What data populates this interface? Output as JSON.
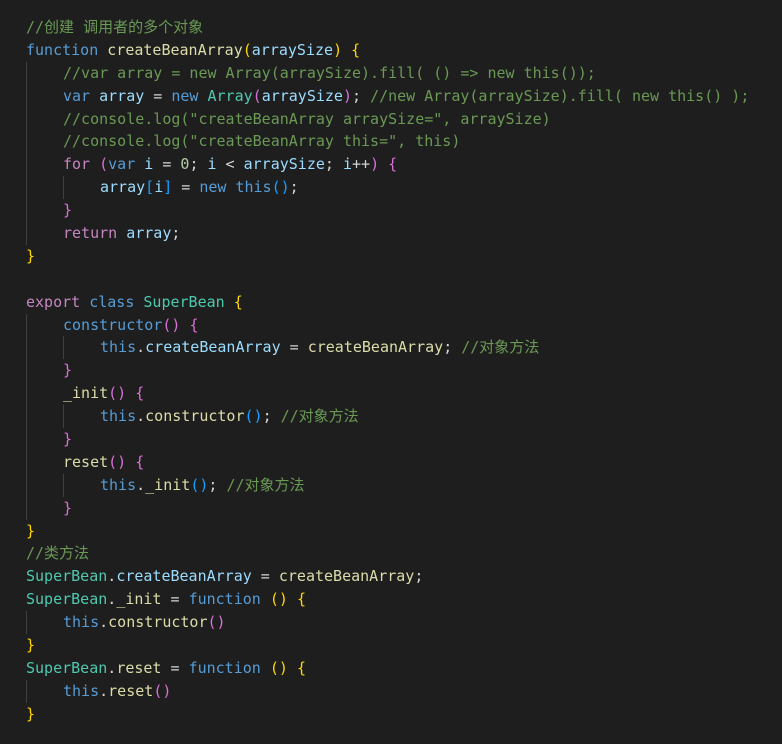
{
  "editor": {
    "language": "javascript",
    "theme_background": "#1e1e1e",
    "lines": [
      {
        "indent": 0,
        "tokens": [
          {
            "t": "//创建 调用者的多个对象",
            "c": "comment"
          }
        ]
      },
      {
        "indent": 0,
        "tokens": [
          {
            "t": "function",
            "c": "kw"
          },
          {
            "t": " ",
            "c": "op"
          },
          {
            "t": "createBeanArray",
            "c": "fn"
          },
          {
            "t": "(",
            "c": "b1"
          },
          {
            "t": "arraySize",
            "c": "var"
          },
          {
            "t": ")",
            "c": "b1"
          },
          {
            "t": " ",
            "c": "op"
          },
          {
            "t": "{",
            "c": "b1"
          }
        ]
      },
      {
        "indent": 1,
        "tokens": [
          {
            "t": "//var array = new Array(arraySize).fill( () => new this());",
            "c": "comment"
          }
        ]
      },
      {
        "indent": 1,
        "tokens": [
          {
            "t": "var",
            "c": "kw"
          },
          {
            "t": " ",
            "c": "op"
          },
          {
            "t": "array",
            "c": "var"
          },
          {
            "t": " = ",
            "c": "op"
          },
          {
            "t": "new",
            "c": "kw"
          },
          {
            "t": " ",
            "c": "op"
          },
          {
            "t": "Array",
            "c": "cls"
          },
          {
            "t": "(",
            "c": "b2"
          },
          {
            "t": "arraySize",
            "c": "var"
          },
          {
            "t": ")",
            "c": "b2"
          },
          {
            "t": "; ",
            "c": "op"
          },
          {
            "t": "//new Array(arraySize).fill( new this() );",
            "c": "comment"
          }
        ]
      },
      {
        "indent": 1,
        "tokens": [
          {
            "t": "//console.log(\"createBeanArray arraySize=\", arraySize)",
            "c": "comment"
          }
        ]
      },
      {
        "indent": 1,
        "tokens": [
          {
            "t": "//console.log(\"createBeanArray this=\", this)",
            "c": "comment"
          }
        ]
      },
      {
        "indent": 1,
        "tokens": [
          {
            "t": "for",
            "c": "ctrl"
          },
          {
            "t": " ",
            "c": "op"
          },
          {
            "t": "(",
            "c": "b2"
          },
          {
            "t": "var",
            "c": "kw"
          },
          {
            "t": " ",
            "c": "op"
          },
          {
            "t": "i",
            "c": "var"
          },
          {
            "t": " = ",
            "c": "op"
          },
          {
            "t": "0",
            "c": "num"
          },
          {
            "t": "; ",
            "c": "op"
          },
          {
            "t": "i",
            "c": "var"
          },
          {
            "t": " < ",
            "c": "op"
          },
          {
            "t": "arraySize",
            "c": "var"
          },
          {
            "t": "; ",
            "c": "op"
          },
          {
            "t": "i",
            "c": "var"
          },
          {
            "t": "++",
            "c": "op"
          },
          {
            "t": ")",
            "c": "b2"
          },
          {
            "t": " ",
            "c": "op"
          },
          {
            "t": "{",
            "c": "b2"
          }
        ]
      },
      {
        "indent": 2,
        "tokens": [
          {
            "t": "array",
            "c": "var"
          },
          {
            "t": "[",
            "c": "b3"
          },
          {
            "t": "i",
            "c": "var"
          },
          {
            "t": "]",
            "c": "b3"
          },
          {
            "t": " = ",
            "c": "op"
          },
          {
            "t": "new",
            "c": "kw"
          },
          {
            "t": " ",
            "c": "op"
          },
          {
            "t": "this",
            "c": "kw"
          },
          {
            "t": "()",
            "c": "b3"
          },
          {
            "t": ";",
            "c": "op"
          }
        ]
      },
      {
        "indent": 1,
        "tokens": [
          {
            "t": "}",
            "c": "b2"
          }
        ]
      },
      {
        "indent": 1,
        "tokens": [
          {
            "t": "return",
            "c": "ctrl"
          },
          {
            "t": " ",
            "c": "op"
          },
          {
            "t": "array",
            "c": "var"
          },
          {
            "t": ";",
            "c": "op"
          }
        ]
      },
      {
        "indent": 0,
        "tokens": [
          {
            "t": "}",
            "c": "b1"
          }
        ]
      },
      {
        "indent": 0,
        "tokens": []
      },
      {
        "indent": 0,
        "tokens": [
          {
            "t": "export",
            "c": "ctrl"
          },
          {
            "t": " ",
            "c": "op"
          },
          {
            "t": "class",
            "c": "kw"
          },
          {
            "t": " ",
            "c": "op"
          },
          {
            "t": "SuperBean",
            "c": "cls"
          },
          {
            "t": " ",
            "c": "op"
          },
          {
            "t": "{",
            "c": "b1"
          }
        ]
      },
      {
        "indent": 1,
        "tokens": [
          {
            "t": "constructor",
            "c": "kw"
          },
          {
            "t": "()",
            "c": "b2"
          },
          {
            "t": " ",
            "c": "op"
          },
          {
            "t": "{",
            "c": "b2"
          }
        ]
      },
      {
        "indent": 2,
        "tokens": [
          {
            "t": "this",
            "c": "kw"
          },
          {
            "t": ".",
            "c": "op"
          },
          {
            "t": "createBeanArray",
            "c": "var"
          },
          {
            "t": " = ",
            "c": "op"
          },
          {
            "t": "createBeanArray",
            "c": "fn"
          },
          {
            "t": "; ",
            "c": "op"
          },
          {
            "t": "//对象方法",
            "c": "comment"
          }
        ]
      },
      {
        "indent": 1,
        "tokens": [
          {
            "t": "}",
            "c": "b2"
          }
        ]
      },
      {
        "indent": 1,
        "tokens": [
          {
            "t": "_init",
            "c": "fn"
          },
          {
            "t": "()",
            "c": "b2"
          },
          {
            "t": " ",
            "c": "op"
          },
          {
            "t": "{",
            "c": "b2"
          }
        ]
      },
      {
        "indent": 2,
        "tokens": [
          {
            "t": "this",
            "c": "kw"
          },
          {
            "t": ".",
            "c": "op"
          },
          {
            "t": "constructor",
            "c": "fn"
          },
          {
            "t": "()",
            "c": "b3"
          },
          {
            "t": "; ",
            "c": "op"
          },
          {
            "t": "//对象方法",
            "c": "comment"
          }
        ]
      },
      {
        "indent": 1,
        "tokens": [
          {
            "t": "}",
            "c": "b2"
          }
        ]
      },
      {
        "indent": 1,
        "tokens": [
          {
            "t": "reset",
            "c": "fn"
          },
          {
            "t": "()",
            "c": "b2"
          },
          {
            "t": " ",
            "c": "op"
          },
          {
            "t": "{",
            "c": "b2"
          }
        ]
      },
      {
        "indent": 2,
        "tokens": [
          {
            "t": "this",
            "c": "kw"
          },
          {
            "t": ".",
            "c": "op"
          },
          {
            "t": "_init",
            "c": "fn"
          },
          {
            "t": "()",
            "c": "b3"
          },
          {
            "t": "; ",
            "c": "op"
          },
          {
            "t": "//对象方法",
            "c": "comment"
          }
        ]
      },
      {
        "indent": 1,
        "tokens": [
          {
            "t": "}",
            "c": "b2"
          }
        ]
      },
      {
        "indent": 0,
        "tokens": [
          {
            "t": "}",
            "c": "b1"
          }
        ]
      },
      {
        "indent": 0,
        "tokens": [
          {
            "t": "//类方法",
            "c": "comment"
          }
        ]
      },
      {
        "indent": 0,
        "tokens": [
          {
            "t": "SuperBean",
            "c": "cls"
          },
          {
            "t": ".",
            "c": "op"
          },
          {
            "t": "createBeanArray",
            "c": "var"
          },
          {
            "t": " = ",
            "c": "op"
          },
          {
            "t": "createBeanArray",
            "c": "fn"
          },
          {
            "t": ";",
            "c": "op"
          }
        ]
      },
      {
        "indent": 0,
        "tokens": [
          {
            "t": "SuperBean",
            "c": "cls"
          },
          {
            "t": ".",
            "c": "op"
          },
          {
            "t": "_init",
            "c": "fn"
          },
          {
            "t": " = ",
            "c": "op"
          },
          {
            "t": "function",
            "c": "kw"
          },
          {
            "t": " ",
            "c": "op"
          },
          {
            "t": "()",
            "c": "b1"
          },
          {
            "t": " ",
            "c": "op"
          },
          {
            "t": "{",
            "c": "b1"
          }
        ]
      },
      {
        "indent": 1,
        "tokens": [
          {
            "t": "this",
            "c": "kw"
          },
          {
            "t": ".",
            "c": "op"
          },
          {
            "t": "constructor",
            "c": "fn"
          },
          {
            "t": "()",
            "c": "b2"
          }
        ]
      },
      {
        "indent": 0,
        "tokens": [
          {
            "t": "}",
            "c": "b1"
          }
        ]
      },
      {
        "indent": 0,
        "tokens": [
          {
            "t": "SuperBean",
            "c": "cls"
          },
          {
            "t": ".",
            "c": "op"
          },
          {
            "t": "reset",
            "c": "fn"
          },
          {
            "t": " = ",
            "c": "op"
          },
          {
            "t": "function",
            "c": "kw"
          },
          {
            "t": " ",
            "c": "op"
          },
          {
            "t": "()",
            "c": "b1"
          },
          {
            "t": " ",
            "c": "op"
          },
          {
            "t": "{",
            "c": "b1"
          }
        ]
      },
      {
        "indent": 1,
        "tokens": [
          {
            "t": "this",
            "c": "kw"
          },
          {
            "t": ".",
            "c": "op"
          },
          {
            "t": "reset",
            "c": "fn"
          },
          {
            "t": "()",
            "c": "b2"
          }
        ]
      },
      {
        "indent": 0,
        "tokens": [
          {
            "t": "}",
            "c": "b1"
          }
        ]
      }
    ]
  }
}
